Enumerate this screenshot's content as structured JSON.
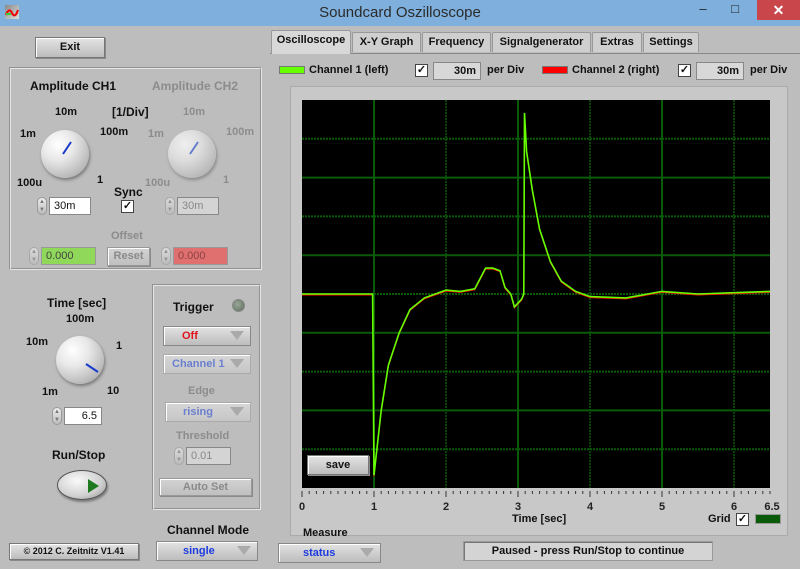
{
  "window": {
    "title": "Soundcard Oszilloscope",
    "minimize": "–",
    "maximize": "□",
    "close": "✕"
  },
  "left": {
    "exit_label": "Exit",
    "amplitude": {
      "ch1_title": "Amplitude CH1",
      "ch2_title": "Amplitude CH2",
      "unit": "[1/Div]",
      "scale_labels": [
        "100u",
        "1m",
        "10m",
        "100m",
        "1"
      ],
      "ch1_value": "30m",
      "ch2_value": "30m",
      "sync_label": "Sync",
      "sync_checked": true,
      "offset_label": "Offset",
      "offset_ch1": "0.000",
      "offset_ch2": "0.000",
      "reset_label": "Reset"
    },
    "time": {
      "title": "Time [sec]",
      "scale_labels": [
        "1m",
        "10m",
        "100m",
        "1",
        "10"
      ],
      "value": "6.5"
    },
    "trigger": {
      "title": "Trigger",
      "mode": "Off",
      "channel": "Channel 1",
      "edge_label": "Edge",
      "edge": "rising",
      "threshold_label": "Threshold",
      "threshold": "0.01",
      "autoset_label": "Auto Set"
    },
    "run_stop_label": "Run/Stop",
    "channel_mode_label": "Channel Mode",
    "channel_mode": "single",
    "copyright": "© 2012  C. Zeitnitz V1.41"
  },
  "tabs": [
    {
      "label": "Oscilloscope",
      "active": true
    },
    {
      "label": "X-Y Graph",
      "active": false
    },
    {
      "label": "Frequency",
      "active": false
    },
    {
      "label": "Signalgenerator",
      "active": false
    },
    {
      "label": "Extras",
      "active": false
    },
    {
      "label": "Settings",
      "active": false
    }
  ],
  "channels": {
    "ch1": {
      "label": "Channel 1 (left)",
      "color": "#66ff00",
      "enabled": true,
      "per_div": "30m",
      "per_div_label": "per Div"
    },
    "ch2": {
      "label": "Channel 2 (right)",
      "color": "#ff0000",
      "enabled": true,
      "per_div": "30m",
      "per_div_label": "per Div"
    }
  },
  "plot": {
    "save_label": "save",
    "x_ticks": [
      "0",
      "1",
      "2",
      "3",
      "4",
      "5",
      "6",
      "6.5"
    ],
    "xlabel": "Time [sec]",
    "grid_label": "Grid",
    "grid_checked": true,
    "grid_color": "#0a5a0a",
    "trace_ch1": [
      [
        0,
        0
      ],
      [
        0.98,
        0
      ],
      [
        1.0,
        -0.14
      ],
      [
        1.1,
        -0.09
      ],
      [
        1.2,
        -0.055
      ],
      [
        1.35,
        -0.03
      ],
      [
        1.5,
        -0.012
      ],
      [
        1.7,
        -0.003
      ],
      [
        2.0,
        0.003
      ],
      [
        2.2,
        0.002
      ],
      [
        2.4,
        0.004
      ],
      [
        2.55,
        0.02
      ],
      [
        2.65,
        0.02
      ],
      [
        2.75,
        0.018
      ],
      [
        2.82,
        0.005
      ],
      [
        2.9,
        0
      ],
      [
        2.95,
        -0.01
      ],
      [
        3.05,
        -0.004
      ],
      [
        3.08,
        0
      ],
      [
        3.09,
        0.14
      ],
      [
        3.12,
        0.11
      ],
      [
        3.2,
        0.08
      ],
      [
        3.3,
        0.05
      ],
      [
        3.45,
        0.025
      ],
      [
        3.6,
        0.01
      ],
      [
        3.8,
        0.002
      ],
      [
        4.0,
        -0.002
      ],
      [
        4.5,
        -0.003
      ],
      [
        5.0,
        0.002
      ],
      [
        5.5,
        0
      ],
      [
        6.0,
        0.001
      ],
      [
        6.5,
        0.002
      ]
    ]
  },
  "chart_data": {
    "type": "line",
    "title": "",
    "xlabel": "Time [sec]",
    "ylabel": "",
    "xlim": [
      0,
      6.5
    ],
    "ylim": [
      -0.15,
      0.15
    ],
    "y_per_div": "30m",
    "grid": true,
    "series": [
      {
        "name": "Channel 1 (left)",
        "x": [
          0,
          0.98,
          1.0,
          1.1,
          1.2,
          1.35,
          1.5,
          1.7,
          2.0,
          2.2,
          2.4,
          2.55,
          2.65,
          2.75,
          2.82,
          2.9,
          2.95,
          3.05,
          3.08,
          3.09,
          3.12,
          3.2,
          3.3,
          3.45,
          3.6,
          3.8,
          4.0,
          4.5,
          5.0,
          5.5,
          6.0,
          6.5
        ],
        "y": [
          0,
          0,
          -0.14,
          -0.09,
          -0.055,
          -0.03,
          -0.012,
          -0.003,
          0.003,
          0.002,
          0.004,
          0.02,
          0.02,
          0.018,
          0.005,
          0,
          -0.01,
          -0.004,
          0,
          0.14,
          0.11,
          0.08,
          0.05,
          0.025,
          0.01,
          0.002,
          -0.002,
          -0.003,
          0.002,
          0,
          0.001,
          0.002
        ]
      }
    ]
  },
  "bottom": {
    "measure_label": "Measure",
    "measure_value": "status",
    "status_text": "Paused - press Run/Stop to continue"
  }
}
